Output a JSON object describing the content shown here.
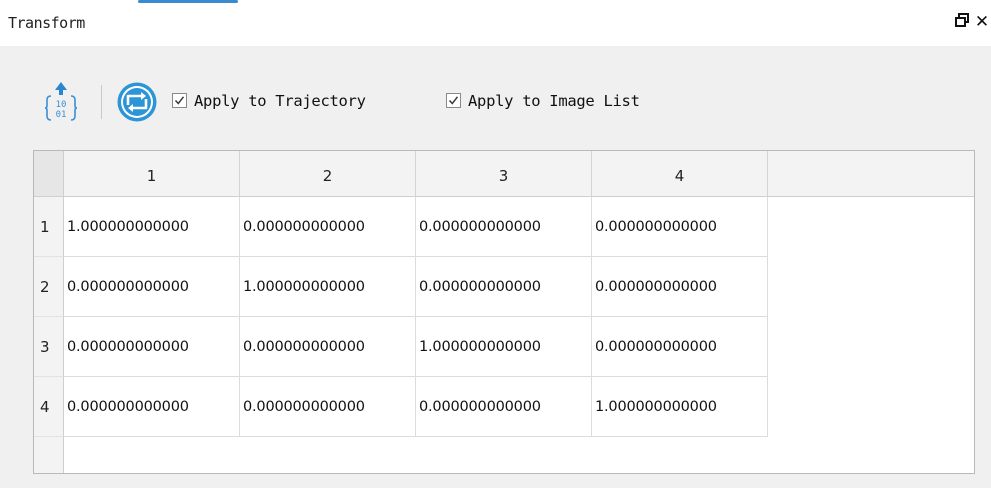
{
  "panel": {
    "title": "Transform",
    "float_label": "🗗",
    "close_label": "✕",
    "accent_color": "#3a8ad1"
  },
  "toolbar": {
    "matrix_tool_icon": "matrix-transform-icon",
    "refresh_tool_icon": "refresh-icon",
    "apply_trajectory": {
      "label": "Apply to Trajectory",
      "checked": true
    },
    "apply_image_list": {
      "label": "Apply to Image List",
      "checked": true
    }
  },
  "table": {
    "columns": [
      "1",
      "2",
      "3",
      "4"
    ],
    "rows": [
      {
        "header": "1",
        "cells": [
          "1.000000000000",
          "0.000000000000",
          "0.000000000000",
          "0.000000000000"
        ]
      },
      {
        "header": "2",
        "cells": [
          "0.000000000000",
          "1.000000000000",
          "0.000000000000",
          "0.000000000000"
        ]
      },
      {
        "header": "3",
        "cells": [
          "0.000000000000",
          "0.000000000000",
          "1.000000000000",
          "0.000000000000"
        ]
      },
      {
        "header": "4",
        "cells": [
          "0.000000000000",
          "0.000000000000",
          "0.000000000000",
          "1.000000000000"
        ]
      }
    ]
  }
}
